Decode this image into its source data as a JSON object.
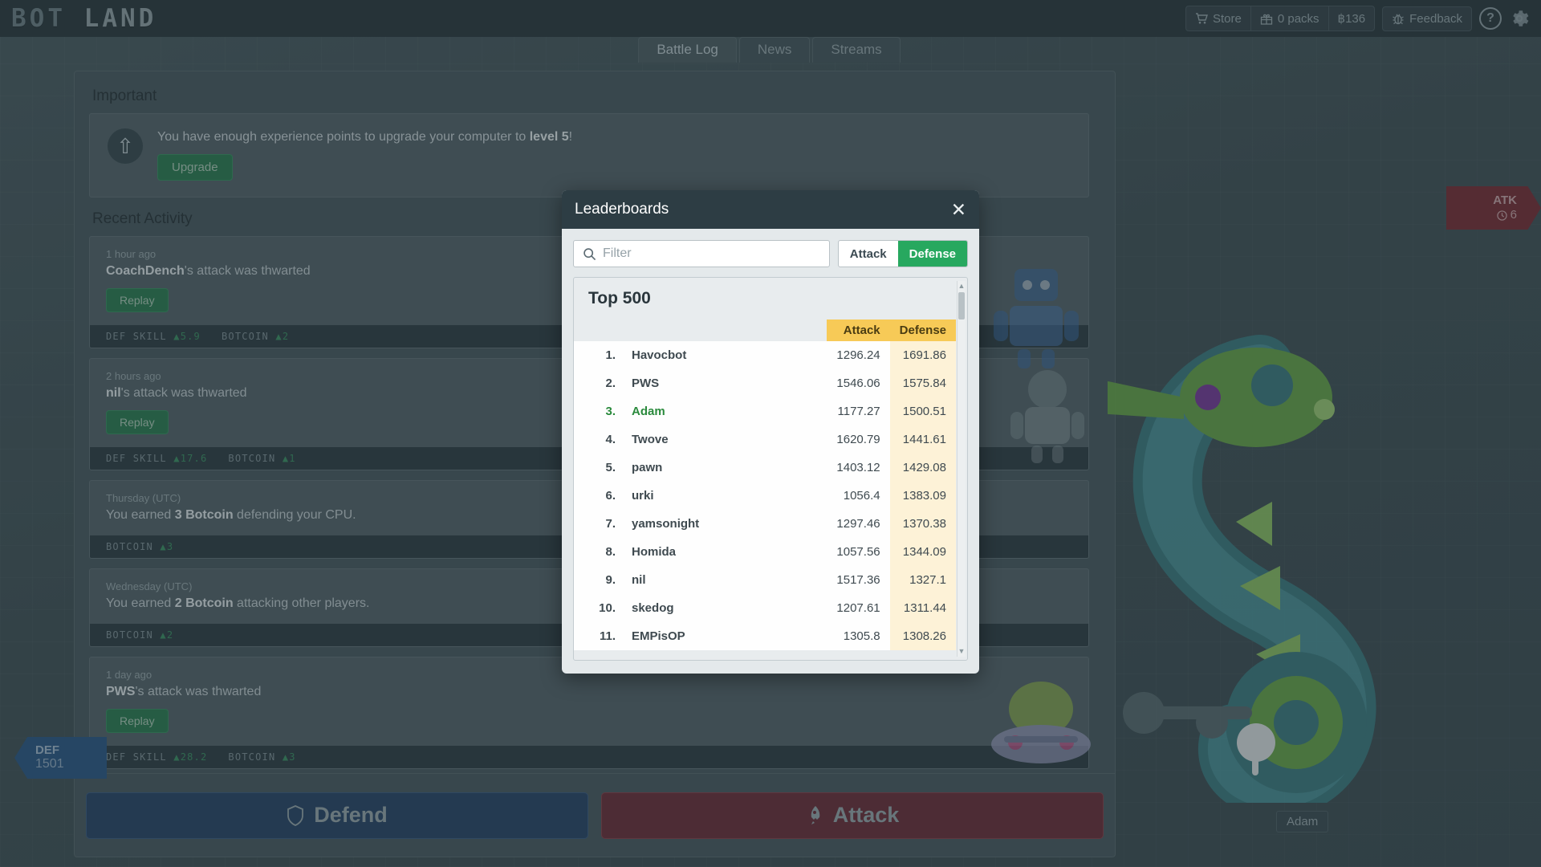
{
  "brand": {
    "name_part1": "BOT",
    "name_part2": "LAND"
  },
  "header": {
    "store_label": "Store",
    "packs_label": "0 packs",
    "coins_label": "฿136",
    "feedback_label": "Feedback",
    "help_label": "?",
    "store_icon": "cart-icon",
    "packs_icon": "gift-icon",
    "feedback_icon": "bug-icon",
    "settings_icon": "gear-icon"
  },
  "tabs": [
    {
      "label": "Battle Log",
      "active": true
    },
    {
      "label": "News",
      "active": false
    },
    {
      "label": "Streams",
      "active": false
    }
  ],
  "important": {
    "section_title": "Important",
    "message_pre": "You have enough experience points to upgrade your computer to ",
    "message_bold": "level 5",
    "message_post": "!",
    "upgrade_label": "Upgrade",
    "icon": "arrow-up-circle-icon"
  },
  "recent_activity": {
    "section_title": "Recent Activity",
    "items": [
      {
        "time": "1 hour ago",
        "actor": "CoachDench",
        "text_rest": "'s attack was thwarted",
        "replay_label": "Replay",
        "stats": [
          {
            "label": "DEF SKILL",
            "value": "5.9"
          },
          {
            "label": "BOTCOIN",
            "value": "2"
          }
        ]
      },
      {
        "time": "2 hours ago",
        "actor": "nil",
        "text_rest": "'s attack was thwarted",
        "replay_label": "Replay",
        "stats": [
          {
            "label": "DEF SKILL",
            "value": "17.6"
          },
          {
            "label": "BOTCOIN",
            "value": "1"
          }
        ]
      },
      {
        "time": "Thursday (UTC)",
        "plain_pre": "You earned ",
        "plain_bold": "3 Botcoin",
        "plain_post": " defending your CPU.",
        "stats": [
          {
            "label": "BOTCOIN",
            "value": "3"
          }
        ]
      },
      {
        "time": "Wednesday (UTC)",
        "plain_pre": "You earned ",
        "plain_bold": "2 Botcoin",
        "plain_post": " attacking other players.",
        "stats": [
          {
            "label": "BOTCOIN",
            "value": "2"
          }
        ]
      },
      {
        "time": "1 day ago",
        "actor": "PWS",
        "text_rest": "'s attack was thwarted",
        "replay_label": "Replay",
        "stats": [
          {
            "label": "DEF SKILL",
            "value": "28.2"
          },
          {
            "label": "BOTCOIN",
            "value": "3"
          }
        ]
      }
    ]
  },
  "action_bar": {
    "defend_label": "Defend",
    "attack_label": "Attack",
    "defend_icon": "shield-icon",
    "attack_icon": "rocket-icon"
  },
  "badges": {
    "def": {
      "label": "DEF",
      "value": "1501"
    },
    "atk": {
      "label": "ATK",
      "value": "6",
      "icon": "clock-icon"
    },
    "nameplate": "Adam"
  },
  "modal": {
    "title": "Leaderboards",
    "close_icon": "close-icon",
    "search": {
      "placeholder": "Filter",
      "value": "",
      "icon": "search-icon"
    },
    "segments": [
      {
        "label": "Attack",
        "selected": false
      },
      {
        "label": "Defense",
        "selected": true
      }
    ],
    "list_title": "Top 500",
    "columns": [
      "",
      "",
      "Attack",
      "Defense"
    ],
    "rows": [
      {
        "rank": "1.",
        "name": "Havocbot",
        "attack": "1296.24",
        "defense": "1691.86",
        "me": false
      },
      {
        "rank": "2.",
        "name": "PWS",
        "attack": "1546.06",
        "defense": "1575.84",
        "me": false
      },
      {
        "rank": "3.",
        "name": "Adam",
        "attack": "1177.27",
        "defense": "1500.51",
        "me": true
      },
      {
        "rank": "4.",
        "name": "Twove",
        "attack": "1620.79",
        "defense": "1441.61",
        "me": false
      },
      {
        "rank": "5.",
        "name": "pawn",
        "attack": "1403.12",
        "defense": "1429.08",
        "me": false
      },
      {
        "rank": "6.",
        "name": "urki",
        "attack": "1056.4",
        "defense": "1383.09",
        "me": false
      },
      {
        "rank": "7.",
        "name": "yamsonight",
        "attack": "1297.46",
        "defense": "1370.38",
        "me": false
      },
      {
        "rank": "8.",
        "name": "Homida",
        "attack": "1057.56",
        "defense": "1344.09",
        "me": false
      },
      {
        "rank": "9.",
        "name": "nil",
        "attack": "1517.36",
        "defense": "1327.1",
        "me": false
      },
      {
        "rank": "10.",
        "name": "skedog",
        "attack": "1207.61",
        "defense": "1311.44",
        "me": false
      },
      {
        "rank": "11.",
        "name": "EMPisOP",
        "attack": "1305.8",
        "defense": "1308.26",
        "me": false
      }
    ]
  },
  "colors": {
    "accent_green": "#27a85f",
    "header_yellow": "#f7ca57",
    "defense_cell": "#fdf2d7",
    "modal_header": "#2d3d44",
    "defend_blue": "#2d4a6b",
    "attack_red": "#6b3540"
  }
}
